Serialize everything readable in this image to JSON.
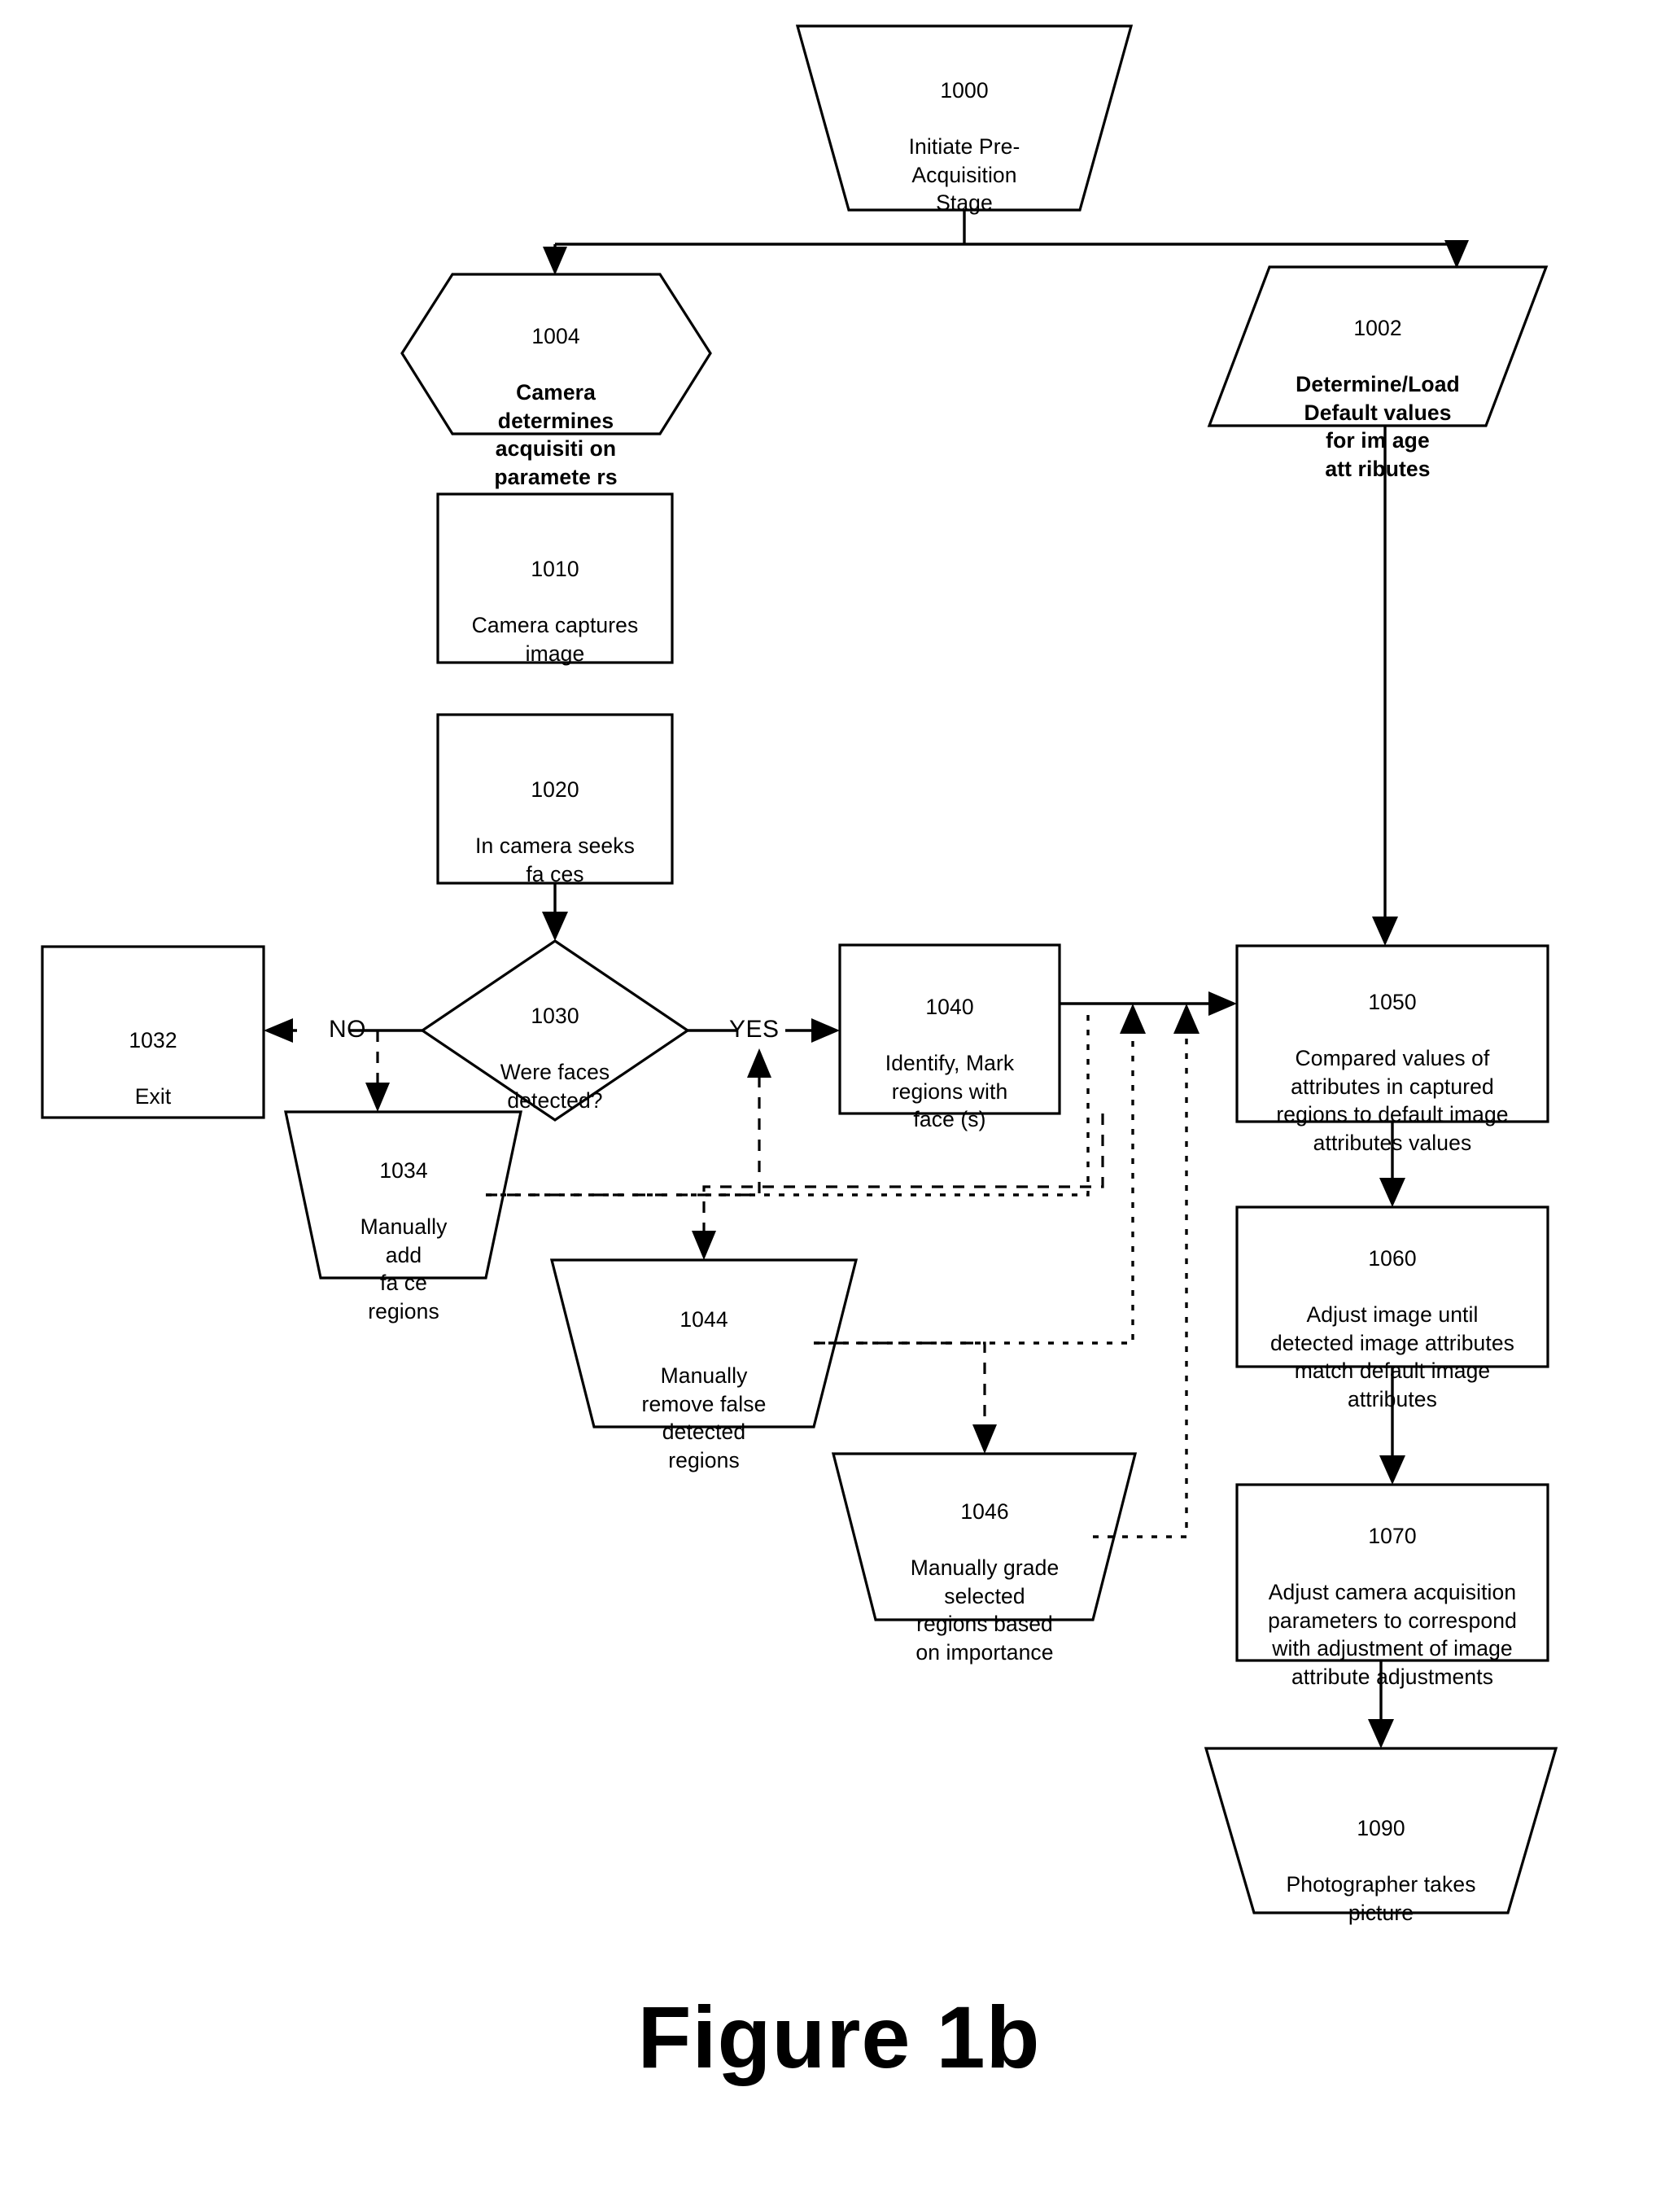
{
  "figure": {
    "caption": "Figure 1b"
  },
  "nodes": {
    "n1000": {
      "id": "1000",
      "text": "Initiate Pre-\nAcquisition\nStage",
      "shape": "trapezoid-down"
    },
    "n1004": {
      "id": "1004",
      "text": "Camera\ndetermines\nacquisiti on\nparamete  rs",
      "shape": "hexagon"
    },
    "n1002": {
      "id": "1002",
      "text": "Determine/Load\nDefault values\nfor  im age\natt ributes",
      "shape": "parallelogram"
    },
    "n1010": {
      "id": "1010",
      "text": "Camera captures\nimage",
      "shape": "rect"
    },
    "n1020": {
      "id": "1020",
      "text": "In camera seeks\nfa ces",
      "shape": "rect"
    },
    "n1030": {
      "id": "1030",
      "text": "Were faces\ndetected?",
      "shape": "diamond"
    },
    "n1032": {
      "id": "1032",
      "text": "Exit",
      "shape": "rect"
    },
    "n1034": {
      "id": "1034",
      "text": "Manually\nadd\nfa ce\nregions",
      "shape": "trapezoid-down"
    },
    "n1040": {
      "id": "1040",
      "text": "Identify, Mark\nregions with\nface (s)",
      "shape": "rect"
    },
    "n1044": {
      "id": "1044",
      "text": "Manually\nremove false\ndetected\nregions",
      "shape": "trapezoid-down"
    },
    "n1046": {
      "id": "1046",
      "text": "Manually grade\nselected\nregions based\non importance",
      "shape": "trapezoid-down"
    },
    "n1050": {
      "id": "1050",
      "text": "Compared values of\nattributes in captured\nregions to default image\nattributes values",
      "shape": "rect"
    },
    "n1060": {
      "id": "1060",
      "text": "Adjust image until\ndetected image attributes\nmatch  default image\nattributes",
      "shape": "rect"
    },
    "n1070": {
      "id": "1070",
      "text": "Adjust camera acquisition\nparameters to correspond\nwith  adjustment of image\nattribute adjustments",
      "shape": "rect"
    },
    "n1090": {
      "id": "1090",
      "text": "Photographer takes\npicture",
      "shape": "trapezoid-down"
    }
  },
  "branch_labels": {
    "no": "NO",
    "yes": "YES"
  },
  "colors": {
    "stroke": "#000000",
    "fill": "#ffffff",
    "background": "#ffffff"
  }
}
